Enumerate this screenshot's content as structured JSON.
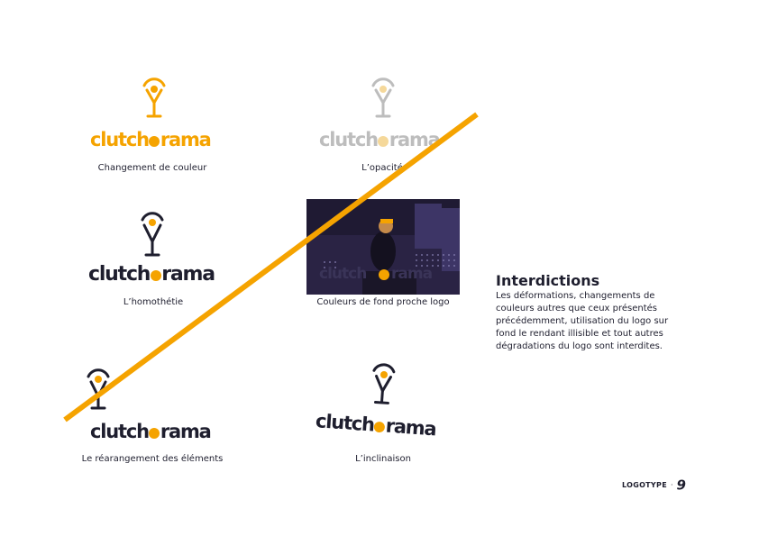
{
  "colors": {
    "accent": "#f5a300",
    "dark": "#1e1e2e",
    "muted": "#bdbdbd",
    "photo_bg": "#2a2344"
  },
  "logo": {
    "part1": "clutch",
    "part2": "rama"
  },
  "examples": [
    {
      "caption": "Changement de couleur",
      "variant": "orange"
    },
    {
      "caption": "L’opacité",
      "variant": "faded"
    },
    {
      "caption": "L’homothétie",
      "variant": "stretched"
    },
    {
      "caption": "Couleurs de fond proche logo",
      "variant": "on-photo"
    },
    {
      "caption": "Le réarangement des éléments",
      "variant": "rearranged"
    },
    {
      "caption": "L’inclinaison",
      "variant": "tilted"
    }
  ],
  "section": {
    "title": "Interdictions",
    "body": "Les déformations, changements de couleurs autres que ceux présentés précédemment, utilisation du logo sur fond le rendant illisible et tout autres dégradations du logo sont interdites."
  },
  "footer": {
    "section_label": "LOGOTYPE",
    "separator": "·",
    "page_number": "9"
  },
  "icons": {
    "logo_mark": "microphone-glass-icon",
    "prohibited_strike": "strike-line"
  }
}
